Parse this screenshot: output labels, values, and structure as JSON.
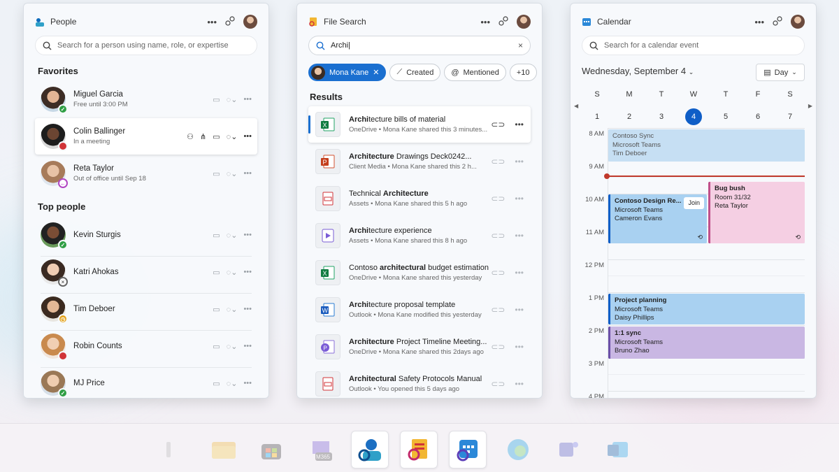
{
  "people": {
    "title": "People",
    "search_placeholder": "Search for a person using name, role, or expertise",
    "favorites_label": "Favorites",
    "top_people_label": "Top people",
    "favorites": [
      {
        "name": "Miguel Garcia",
        "status": "Free until 3:00 PM",
        "presence": "available"
      },
      {
        "name": "Colin Ballinger",
        "status": "In a meeting",
        "presence": "busy"
      },
      {
        "name": "Reta Taylor",
        "status": "Out of office until Sep 18",
        "presence": "ooo"
      }
    ],
    "top_people": [
      {
        "name": "Kevin Sturgis",
        "presence": "available"
      },
      {
        "name": "Katri Ahokas",
        "presence": "offline"
      },
      {
        "name": "Tim Deboer",
        "presence": "away"
      },
      {
        "name": "Robin Counts",
        "presence": "busy"
      },
      {
        "name": "MJ Price",
        "presence": "available"
      }
    ]
  },
  "files": {
    "title": "File Search",
    "search_value": "Archi",
    "chips": [
      "Mona Kane",
      "Created",
      "Mentioned",
      "+10"
    ],
    "results_label": "Results",
    "results": [
      {
        "bold": "Archi",
        "rest": "tecture bills of material",
        "meta": "OneDrive • Mona Kane shared this 3 minutes...",
        "type": "excel"
      },
      {
        "bold": "Architecture",
        "rest": " Drawings Deck0242...",
        "meta": "Client Media • Mona Kane shared this 2 h...",
        "type": "ppt"
      },
      {
        "pre": "Technical ",
        "bold": "Architecture",
        "rest": "",
        "meta": "Assets • Mona Kane shared this 5 h ago",
        "type": "pdf"
      },
      {
        "bold": "Archi",
        "rest": "tecture experience",
        "meta": "Assets • Mona Kane shared this 8 h ago",
        "type": "video"
      },
      {
        "pre": "Contoso ",
        "bold": "architectural",
        "rest": " budget estimation",
        "meta": "OneDrive • Mona Kane shared this yesterday",
        "type": "excel"
      },
      {
        "bold": "Archi",
        "rest": "tecture proposal template",
        "meta": "Outlook • Mona Kane modified this yesterday",
        "type": "word"
      },
      {
        "bold": "Architecture",
        "rest": " Project Timeline Meeting...",
        "meta": "OneDrive • Mona Kane shared this 2days ago",
        "type": "loop"
      },
      {
        "bold": "Architectural",
        "rest": " Safety Protocols Manual",
        "meta": "Outlook • You opened this 5 days ago",
        "type": "pdf"
      }
    ]
  },
  "calendar": {
    "title": "Calendar",
    "search_placeholder": "Search for a calendar event",
    "date_label": "Wednesday, September 4",
    "view_label": "Day",
    "weekdays": [
      "S",
      "M",
      "T",
      "W",
      "T",
      "F",
      "S"
    ],
    "days": [
      "1",
      "2",
      "3",
      "4",
      "5",
      "6",
      "7"
    ],
    "today_index": 3,
    "hours": [
      "8 AM",
      "9 AM",
      "10 AM",
      "11 AM",
      "12 PM",
      "1 PM",
      "2 PM",
      "3 PM",
      "4 PM"
    ],
    "events": [
      {
        "title": "Contoso Sync",
        "l2": "Microsoft Teams",
        "l3": "Tim Deboer",
        "color": "#c6dff3",
        "faded": true
      },
      {
        "title": "Contoso Design Re...",
        "l2": "Microsoft Teams",
        "l3": "Cameron Evans",
        "join": "Join",
        "color": "#a9d1f1"
      },
      {
        "title": "Bug bush",
        "l2": "Room 31/32",
        "l3": "Reta Taylor",
        "color": "#f5cfe3"
      },
      {
        "title": "Project planning",
        "l2": "Microsoft Teams",
        "l3": "Daisy Phillips",
        "color": "#a9d1f1"
      },
      {
        "title": "1:1 sync",
        "l2": "Microsoft Teams",
        "l3": "Bruno Zhao",
        "color": "#c9b7e3"
      }
    ]
  },
  "taskbar": {
    "items": [
      "file-explorer-icon",
      "store-icon",
      "m365-icon",
      "people-app-icon",
      "file-search-app-icon",
      "calendar-app-icon",
      "edge-icon",
      "teams-icon",
      "outlook-icon"
    ],
    "m365_label": "M365"
  },
  "colors": {
    "accent": "#1a6fd0",
    "available": "#2f9e44",
    "busy": "#d13438",
    "away": "#e3a21a",
    "ooo": "#b146c2"
  }
}
